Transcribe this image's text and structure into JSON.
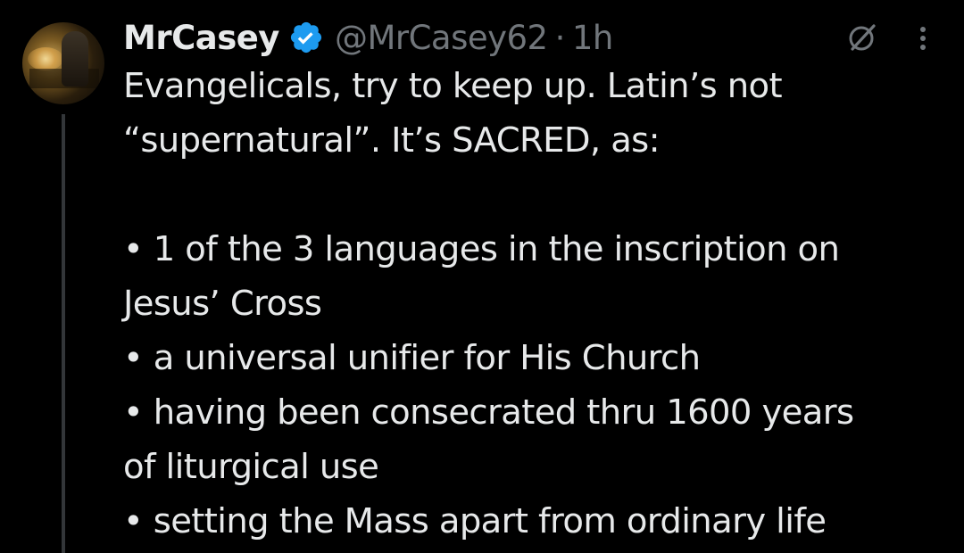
{
  "post": {
    "author": {
      "display_name": "MrCasey",
      "verified": true,
      "handle": "@MrCasey62",
      "separator": "·",
      "time": "1h"
    },
    "avatar_icon": "profile-photo",
    "icons": {
      "verified": "verified-badge-icon",
      "grok": "grok-icon",
      "more": "more-options-icon"
    },
    "colors": {
      "background": "#000000",
      "text": "#e7e9ea",
      "secondary_text": "#71767b",
      "verified_blue": "#1d9bf0",
      "thread_line": "#333639"
    },
    "body": {
      "intro_line1": "Evangelicals, try to keep up. Latin’s not",
      "intro_line2": "“supernatural”. It’s SACRED, as:",
      "bullets": [
        {
          "line1": "• 1 of the 3 languages in the inscription on",
          "line2": "Jesus’ Cross"
        },
        {
          "line1": "• a universal unifier for His Church"
        },
        {
          "line1": "• having been consecrated thru 1600 years",
          "line2": "of liturgical use"
        },
        {
          "line1": "• setting the Mass apart from ordinary life"
        }
      ]
    }
  }
}
